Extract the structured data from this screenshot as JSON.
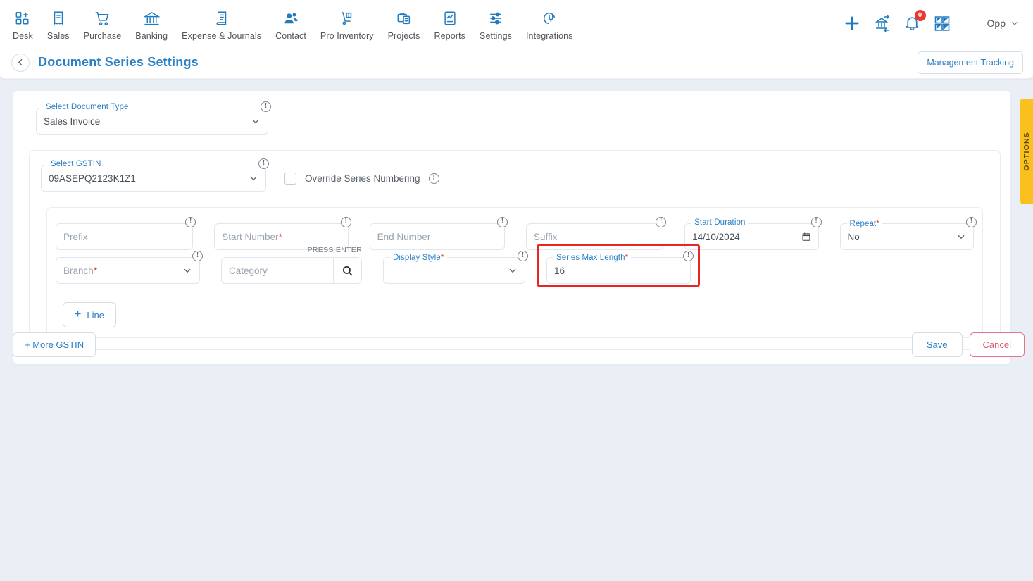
{
  "topnav": {
    "items": [
      {
        "label": "Desk",
        "icon": "dashboard-add-icon"
      },
      {
        "label": "Sales",
        "icon": "receipt-icon"
      },
      {
        "label": "Purchase",
        "icon": "cart-icon"
      },
      {
        "label": "Banking",
        "icon": "bank-icon"
      },
      {
        "label": "Expense & Journals",
        "icon": "journal-book-icon"
      },
      {
        "label": "Contact",
        "icon": "people-icon"
      },
      {
        "label": "Pro Inventory",
        "icon": "hand-truck-icon"
      },
      {
        "label": "Projects",
        "icon": "briefcase-document-icon"
      },
      {
        "label": "Reports",
        "icon": "report-chart-icon"
      },
      {
        "label": "Settings",
        "icon": "sliders-icon"
      },
      {
        "label": "Integrations",
        "icon": "plug-circle-icon"
      }
    ],
    "actions": [
      {
        "name": "add-icon"
      },
      {
        "name": "bank-transfer-icon"
      },
      {
        "name": "notification-bell-icon",
        "badge": "0"
      },
      {
        "name": "apps-grid-icon"
      }
    ],
    "user": {
      "name": "Opp",
      "caret": "chevron-down-icon"
    }
  },
  "header": {
    "back_icon": "chevron-left-icon",
    "title": "Document Series Settings",
    "management_tracking": "Management Tracking"
  },
  "form": {
    "document_type": {
      "label": "Select Document Type",
      "value": "Sales Invoice",
      "info": "!"
    },
    "gstin": {
      "label": "Select GSTIN",
      "value": "09ASEPQ2123K1Z1",
      "info": "!"
    },
    "override": {
      "label": "Override Series Numbering",
      "checked": false,
      "info": "!"
    },
    "row1": {
      "prefix": {
        "placeholder": "Prefix",
        "value": "",
        "required": false,
        "info": "!"
      },
      "start_number": {
        "placeholder": "Start Number",
        "value": "",
        "required": true,
        "info": "!"
      },
      "end_number": {
        "placeholder": "End Number",
        "value": "",
        "required": false,
        "info": "!"
      },
      "suffix": {
        "placeholder": "Suffix",
        "value": "",
        "required": false,
        "info": "!"
      },
      "start_duration": {
        "label": "Start Duration",
        "value": "14/10/2024",
        "required": false,
        "info": "!",
        "icon": "calendar-icon"
      },
      "repeat": {
        "label": "Repeat",
        "value": "No",
        "required": true,
        "info": "!"
      }
    },
    "row2": {
      "branch": {
        "placeholder": "Branch",
        "value": "",
        "required": true,
        "info": "!"
      },
      "category": {
        "placeholder": "Category",
        "value": "",
        "hint": "PRESS ENTER",
        "icon": "search-icon"
      },
      "display_style": {
        "label": "Display Style",
        "value": "",
        "required": true,
        "info": "!"
      },
      "series_max_length": {
        "label": "Series Max Length",
        "value": "16",
        "required": true,
        "info": "!",
        "highlighted": true
      }
    },
    "add_line": "Line",
    "add_line_glyph": "+"
  },
  "footer": {
    "more_gstin": "+ More GSTIN",
    "save": "Save",
    "cancel": "Cancel"
  },
  "options_tab": {
    "label": "OPTIONS"
  },
  "colors": {
    "accent_blue": "#2b7fc4",
    "page_bg": "#eaeff6",
    "highlight_red": "#e8251f",
    "badge_red": "#e8392c",
    "options_yellow": "#fcc01e",
    "cancel_red": "#e05c73"
  }
}
